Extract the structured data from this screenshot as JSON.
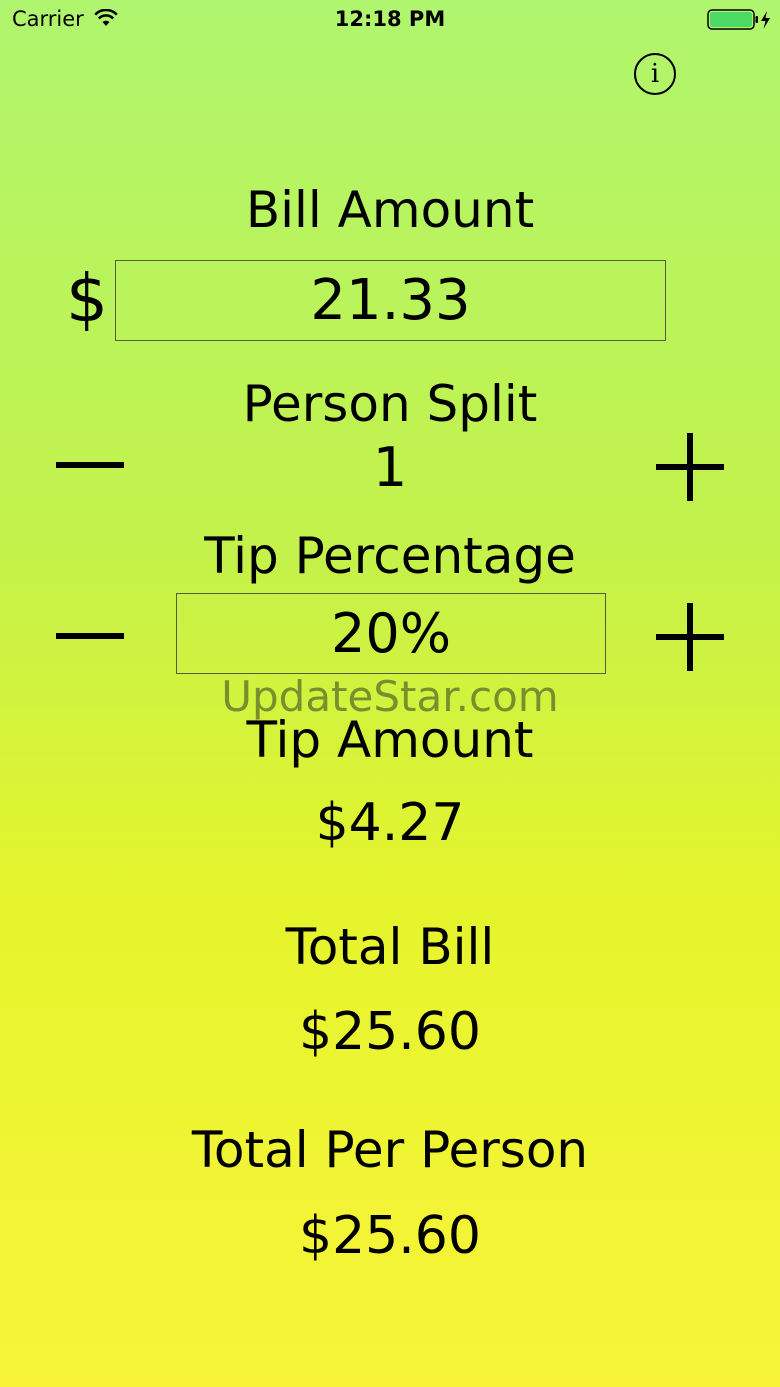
{
  "status_bar": {
    "carrier": "Carrier",
    "time": "12:18 PM",
    "battery_color": "#4cd964"
  },
  "info": {
    "icon": "info-icon",
    "glyph": "i"
  },
  "bill": {
    "label": "Bill Amount",
    "currency_symbol": "$",
    "value": "21.33"
  },
  "split": {
    "label": "Person Split",
    "value": "1"
  },
  "tip": {
    "label": "Tip Percentage",
    "value": "20%"
  },
  "watermark": "UpdateStar.com",
  "tip_amount": {
    "label": "Tip Amount",
    "value": "$4.27"
  },
  "total_bill": {
    "label": "Total Bill",
    "value": "$25.60"
  },
  "total_per_person": {
    "label": "Total Per Person",
    "value": "$25.60"
  }
}
